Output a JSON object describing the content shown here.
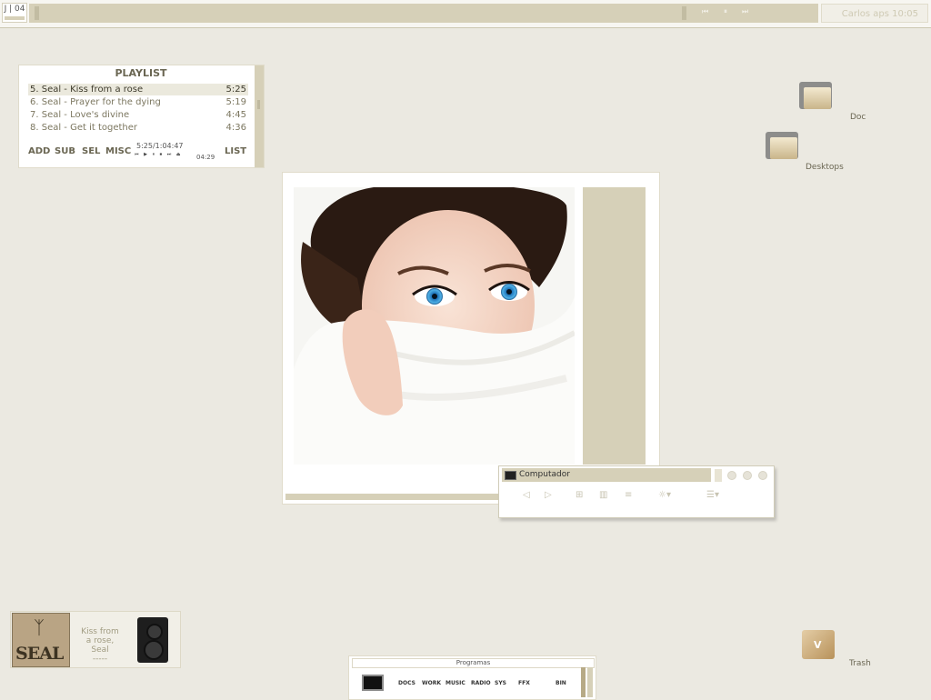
{
  "topbar": {
    "workspace": "J | 04",
    "media_controls": {
      "prev": "⏮",
      "pause": "⏸",
      "next": "⏭"
    },
    "clock": "Carlos  aps 10:05"
  },
  "playlist": {
    "title": "PLAYLIST",
    "tracks": [
      {
        "title": "5. Seal - Kiss from a rose",
        "duration": "5:25",
        "selected": true
      },
      {
        "title": "6. Seal - Prayer for the dying",
        "duration": "5:19",
        "selected": false
      },
      {
        "title": "7. Seal - Love's divine",
        "duration": "4:45",
        "selected": false
      },
      {
        "title": "8. Seal - Get it together",
        "duration": "4:36",
        "selected": false
      }
    ],
    "buttons": {
      "add": "ADD",
      "sub": "SUB",
      "sel": "SEL",
      "misc": "MISC",
      "list": "LIST"
    },
    "time_total": "5:25/1:04:47",
    "elapsed": "04:29",
    "mini_controls": "⏮ ▶ ⏸ ⏹ ⏭ ⏏"
  },
  "filemanager": {
    "title": "Computador",
    "tools": [
      "◁",
      "▷",
      "⊞",
      "▥",
      "≡",
      "☼▾",
      "☰▾"
    ]
  },
  "desktop_icons": [
    {
      "label": "Doc",
      "icon": "folder-icon"
    },
    {
      "label": "Desktops",
      "icon": "folder-icon"
    },
    {
      "label": "Trash",
      "icon": "trash-icon"
    }
  ],
  "now_playing": {
    "album_text": "SEAL",
    "track_line1": "Kiss from",
    "track_line2": "a rose,",
    "artist": "Seal",
    "extra": "-----"
  },
  "dock": {
    "title": "Programas",
    "items": [
      "DOCS",
      "WORK",
      "MUSIC",
      "RADIO",
      "SYS",
      "FFX",
      "BIN"
    ]
  },
  "colors": {
    "background": "#ebe9e1",
    "accent": "#d6d0b8",
    "text": "#6a6652"
  }
}
